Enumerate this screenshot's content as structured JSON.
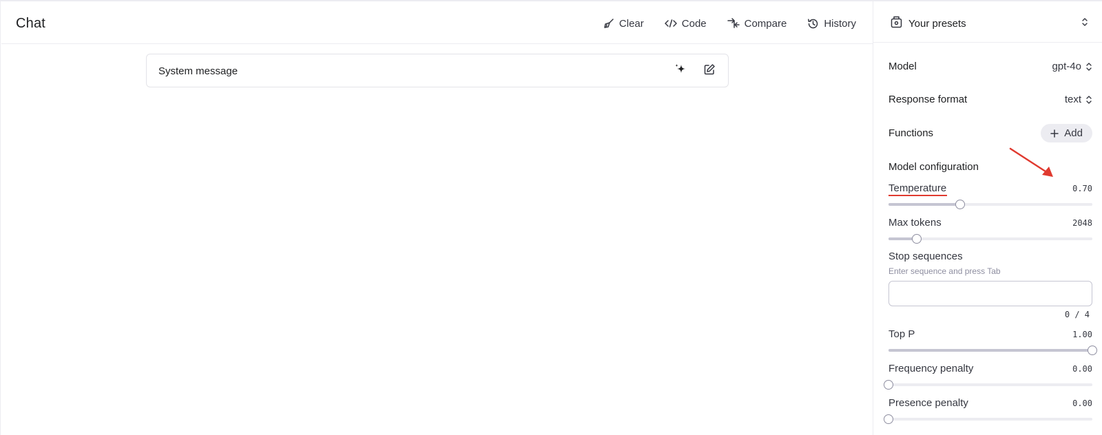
{
  "header": {
    "title": "Chat",
    "actions": [
      {
        "label": "Clear",
        "icon": "broom-icon"
      },
      {
        "label": "Code",
        "icon": "code-icon"
      },
      {
        "label": "Compare",
        "icon": "compare-icon"
      },
      {
        "label": "History",
        "icon": "history-icon"
      }
    ]
  },
  "system_message": {
    "label": "System message",
    "icons": [
      "sparkle-icon",
      "edit-icon"
    ]
  },
  "sidebar": {
    "presets_label": "Your presets",
    "model": {
      "label": "Model",
      "value": "gpt-4o"
    },
    "response_format": {
      "label": "Response format",
      "value": "text"
    },
    "functions": {
      "label": "Functions",
      "add_label": "Add"
    },
    "model_config_title": "Model configuration",
    "params": {
      "temperature": {
        "label": "Temperature",
        "value": "0.70",
        "fraction": 0.35
      },
      "max_tokens": {
        "label": "Max tokens",
        "value": "2048",
        "fraction": 0.14
      },
      "top_p": {
        "label": "Top P",
        "value": "1.00",
        "fraction": 1.0
      },
      "frequency_penalty": {
        "label": "Frequency penalty",
        "value": "0.00",
        "fraction": 0.0
      },
      "presence_penalty": {
        "label": "Presence penalty",
        "value": "0.00",
        "fraction": 0.0
      }
    },
    "stop_sequences": {
      "label": "Stop sequences",
      "hint": "Enter sequence and press Tab",
      "value": "",
      "counter": "0 / 4"
    }
  },
  "colors": {
    "annotation": "#e03a2f",
    "border": "#ececf1",
    "slider_fill": "#c5c5d2"
  }
}
